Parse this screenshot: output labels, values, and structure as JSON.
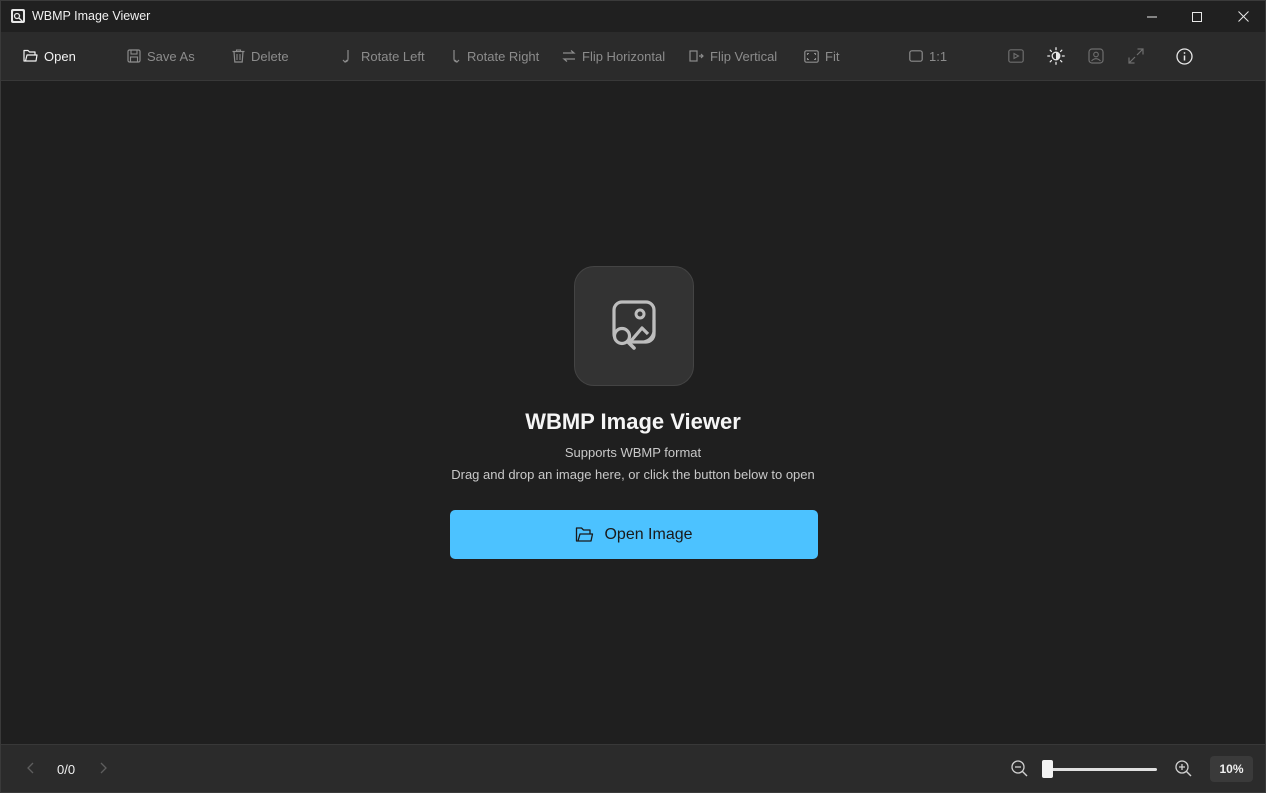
{
  "window": {
    "title": "WBMP Image Viewer"
  },
  "toolbar": {
    "open_label": "Open",
    "save_as_label": "Save As",
    "delete_label": "Delete",
    "rotate_left_label": "Rotate Left",
    "rotate_right_label": "Rotate Right",
    "flip_horizontal_label": "Flip Horizontal",
    "flip_vertical_label": "Flip Vertical",
    "fit_label": "Fit",
    "actual_size_label": "1:1",
    "icons": [
      "slideshow-icon",
      "theme-brightness-icon",
      "image-info-icon",
      "fullscreen-icon",
      "about-icon"
    ]
  },
  "empty_state": {
    "title": "WBMP Image Viewer",
    "supports": "Supports WBMP format",
    "hint": "Drag and drop an image here, or click the button below to open",
    "open_button_label": "Open Image"
  },
  "statusbar": {
    "counter": "0/0",
    "zoom_percent": "10%",
    "zoom_fraction": 0.0
  },
  "colors": {
    "accent": "#4cc2ff",
    "background": "#1f1f1f",
    "toolbar": "#2b2b2b"
  }
}
